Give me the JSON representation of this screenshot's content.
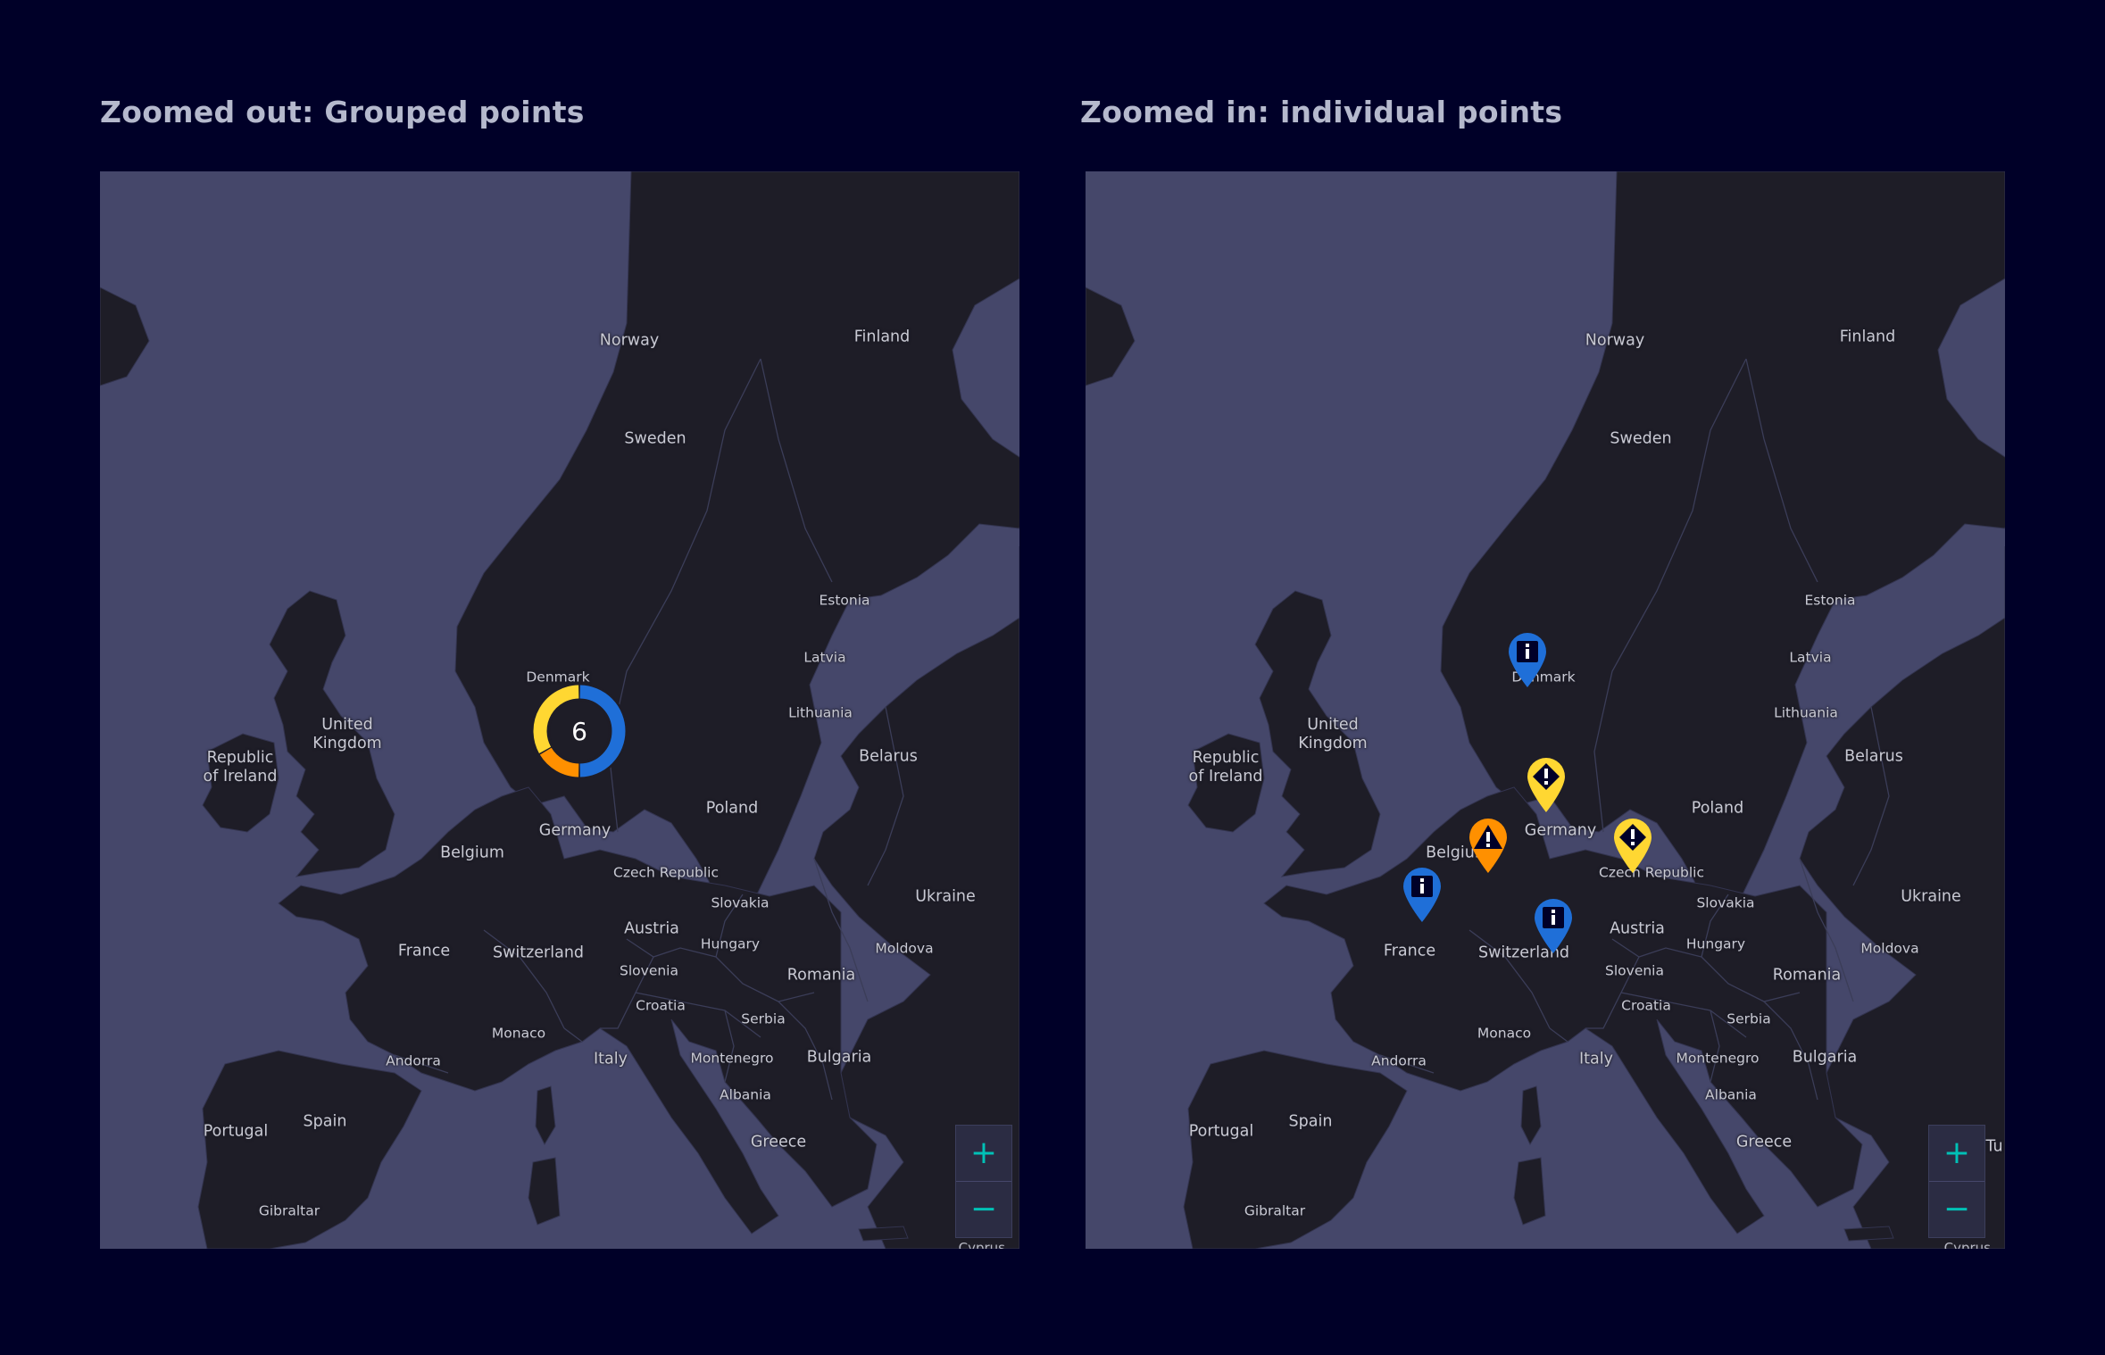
{
  "colors": {
    "page_bg": "#000028",
    "sea": "#45476a",
    "land": "#1e1d27",
    "info": "#1f6fd8",
    "warning": "#ff9000",
    "caution": "#ffd732",
    "zoom_icon": "#00c1b6"
  },
  "left_panel": {
    "title": "Zoomed out: Grouped points",
    "cluster": {
      "count": "6",
      "segments": [
        {
          "status": "info",
          "value": 3
        },
        {
          "status": "warning",
          "value": 1
        },
        {
          "status": "caution",
          "value": 2
        }
      ]
    }
  },
  "right_panel": {
    "title": "Zoomed in: individual points",
    "markers": [
      {
        "status": "info",
        "icon": "info-icon",
        "near": "Denmark"
      },
      {
        "status": "caution",
        "icon": "exclamation-icon",
        "near": "Germany"
      },
      {
        "status": "warning",
        "icon": "warning-triangle-icon",
        "near": "Belgium"
      },
      {
        "status": "caution",
        "icon": "exclamation-icon",
        "near": "Czech Republic"
      },
      {
        "status": "info",
        "icon": "info-icon",
        "near": "France"
      },
      {
        "status": "info",
        "icon": "info-icon",
        "near": "Switzerland"
      }
    ]
  },
  "map_labels": {
    "norway": "Norway",
    "finland": "Finland",
    "sweden": "Sweden",
    "estonia": "Estonia",
    "latvia": "Latvia",
    "lithuania": "Lithuania",
    "denmark": "Denmark",
    "united_kingdom": "United Kingdom",
    "ireland": "Republic of Ireland",
    "belarus": "Belarus",
    "poland": "Poland",
    "germany": "Germany",
    "belgium": "Belgium",
    "czech_republic": "Czech Republic",
    "slovakia": "Slovakia",
    "ukraine": "Ukraine",
    "austria": "Austria",
    "hungary": "Hungary",
    "moldova": "Moldova",
    "france": "France",
    "switzerland": "Switzerland",
    "slovenia": "Slovenia",
    "romania": "Romania",
    "croatia": "Croatia",
    "serbia": "Serbia",
    "monaco": "Monaco",
    "andorra": "Andorra",
    "italy": "Italy",
    "montenegro": "Montenegro",
    "bulgaria": "Bulgaria",
    "albania": "Albania",
    "portugal": "Portugal",
    "spain": "Spain",
    "greece": "Greece",
    "gibraltar": "Gibraltar",
    "cyprus": "Cyprus",
    "turkey_partial": "Tu"
  },
  "zoom_controls": {
    "zoom_in": "+",
    "zoom_out": "−"
  }
}
